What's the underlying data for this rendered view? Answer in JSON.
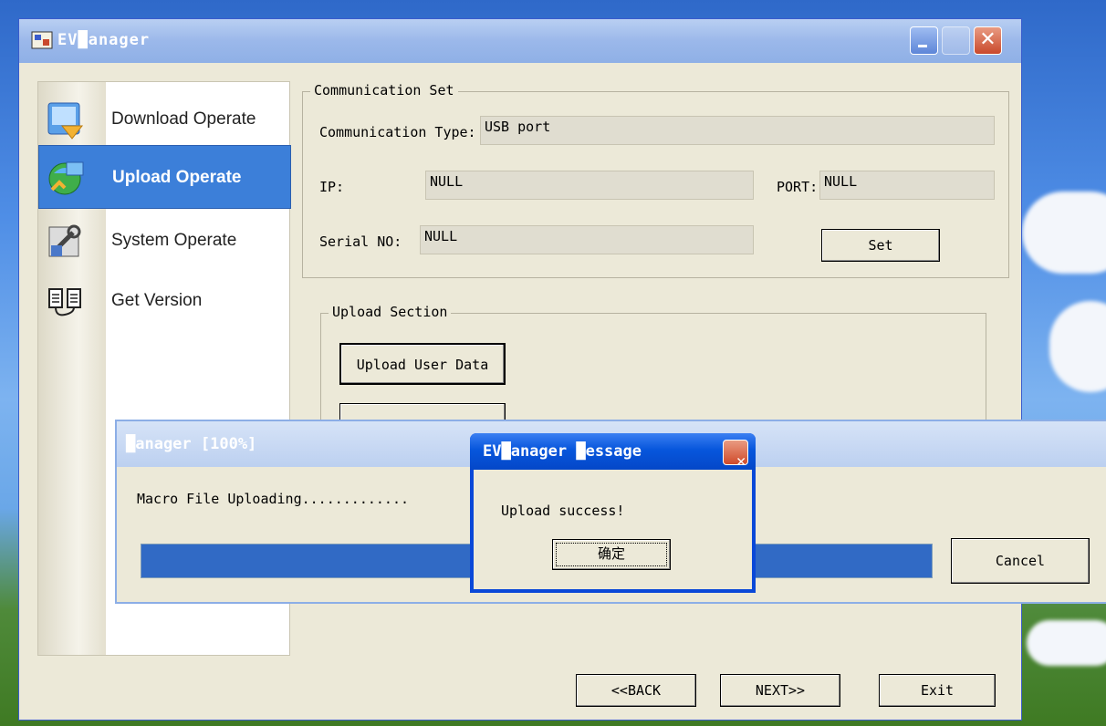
{
  "window": {
    "title": "EV█anager"
  },
  "sidebar": {
    "items": [
      {
        "label": "Download Operate"
      },
      {
        "label": "Upload Operate"
      },
      {
        "label": "System Operate"
      },
      {
        "label": "Get Version"
      }
    ]
  },
  "comm": {
    "legend": "Communication Set",
    "type_label": "Communication Type:",
    "type_value": "USB port",
    "ip_label": "IP:",
    "ip_value": "NULL",
    "port_label": "PORT:",
    "port_value": "NULL",
    "serial_label": "Serial NO:",
    "serial_value": "NULL",
    "set_label": "Set"
  },
  "upload": {
    "legend": "Upload Section",
    "user_data_label": "Upload User Data"
  },
  "nav": {
    "back": "<<BACK",
    "next": "NEXT>>",
    "exit": "Exit"
  },
  "progress": {
    "title": "█anager [100%]",
    "status": "Macro File Uploading.............",
    "fill_fraction": 1.0,
    "cancel": "Cancel"
  },
  "message": {
    "title": "EV█anager █essage",
    "text": "Upload success!",
    "ok": "确定"
  }
}
